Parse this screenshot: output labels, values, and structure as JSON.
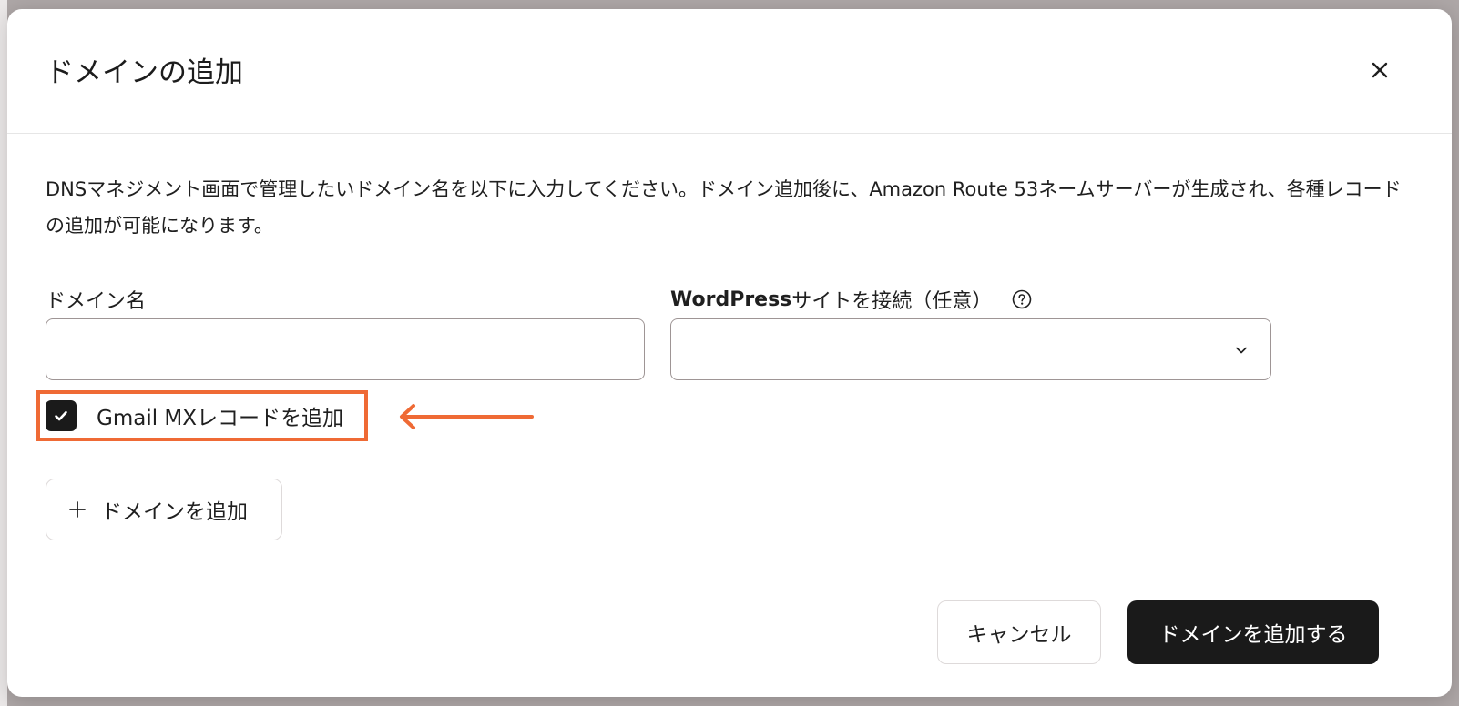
{
  "modal": {
    "title": "ドメインの追加",
    "close_icon": "close-icon"
  },
  "description": "DNSマネジメント画面で管理したいドメイン名を以下に入力してください。ドメイン追加後に、Amazon Route 53ネームサーバーが生成され、各種レコードの追加が可能になります。",
  "form": {
    "domain_label": "ドメイン名",
    "domain_value": "",
    "domain_placeholder": "",
    "wordpress_label_prefix": "WordPress",
    "wordpress_label_suffix": "サイトを接続（任意）",
    "wordpress_help_icon": "question-circle-icon",
    "wordpress_selected": "",
    "gmail_mx_checked": true,
    "gmail_mx_label": "Gmail MXレコードを追加",
    "add_domain_label": "ドメインを追加"
  },
  "footer": {
    "cancel_label": "キャンセル",
    "submit_label": "ドメインを追加する"
  },
  "colors": {
    "highlight": "#ef6a35",
    "primary_button": "#1a1a1a",
    "backdrop": "#aea7a7"
  }
}
